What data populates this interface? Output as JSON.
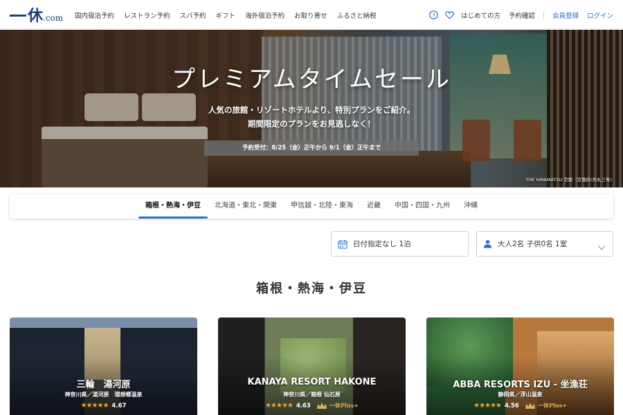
{
  "header": {
    "logo_kanji": "休",
    "logo_suffix": ".com",
    "nav": [
      "国内宿泊予約",
      "レストラン予約",
      "スパ予約",
      "ギフト",
      "海外宿泊予約",
      "お取り寄せ",
      "ふるさと納税"
    ],
    "first_time": "はじめての方",
    "reservation_check": "予約確認",
    "register": "会員登録",
    "login": "ログイン"
  },
  "hero": {
    "title": "プレミアムタイムセール",
    "subtitle_line1": "人気の旅館・リゾートホテルより、特別プランをご紹介。",
    "subtitle_line2": "期間限定のプランをお見逃しなく！",
    "period": "予約受付：8/25（金）正午から 9/1（金）正午まで",
    "credit": "THE HIRAMATSU 京都（京都府/烏丸三条）"
  },
  "regions": [
    {
      "label": "箱根・熱海・伊豆",
      "active": true
    },
    {
      "label": "北海道・東北・関東",
      "active": false
    },
    {
      "label": "甲信越・北陸・東海",
      "active": false
    },
    {
      "label": "近畿",
      "active": false
    },
    {
      "label": "中国・四国・九州",
      "active": false
    },
    {
      "label": "沖縄",
      "active": false
    }
  ],
  "search": {
    "date": "日付指定なし 1泊",
    "guests": "大人2名  子供0名  1室"
  },
  "section_title": "箱根・熱海・伊豆",
  "cards": [
    {
      "name": "三輪　湯河原",
      "location": "神奈川県／湯河原　理想郷温泉",
      "stars": "★★★★★",
      "score": "4.67",
      "plus": ""
    },
    {
      "name": "KANAYA RESORT HAKONE",
      "location": "神奈川県／箱根 仙石原",
      "stars": "★★★★★",
      "score": "4.63",
      "plus": "一休Plus+"
    },
    {
      "name": "ABBA RESORTS IZU - 坐漁荘",
      "location": "静岡県／浮山温泉",
      "stars": "★★★★★",
      "score": "4.56",
      "plus": "一休Plus+"
    }
  ],
  "colors": {
    "brand": "#1a3f7a",
    "accent": "#2a6fc9",
    "star": "#f2a23a"
  }
}
